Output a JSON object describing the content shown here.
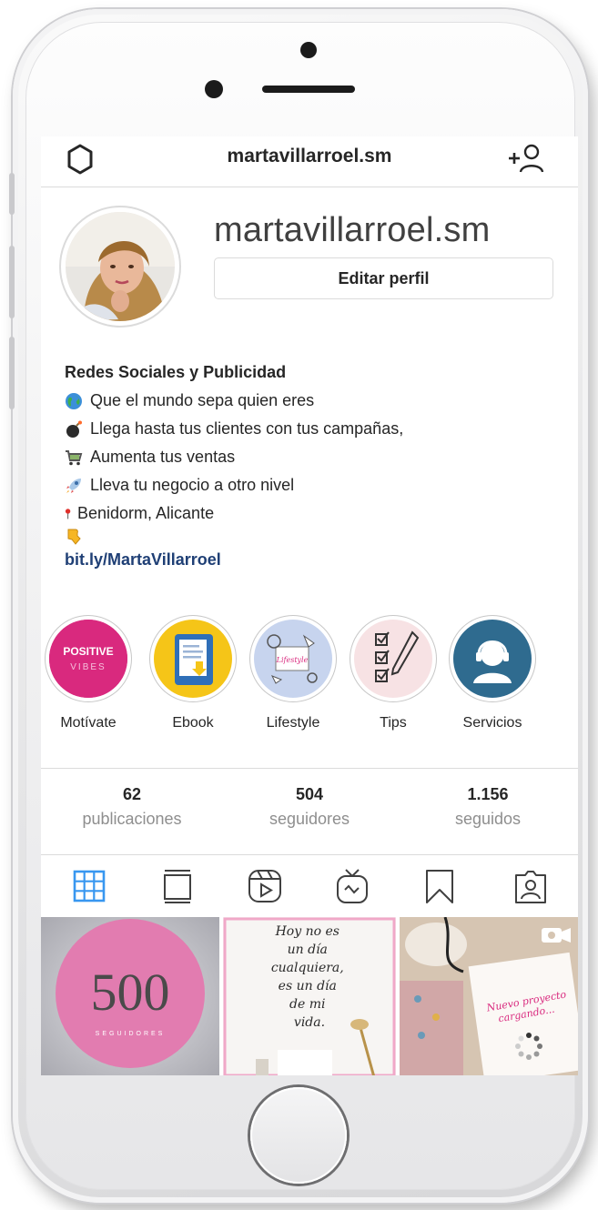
{
  "header": {
    "title": "martavillarroel.sm"
  },
  "profile": {
    "username": "martavillarroel.sm",
    "edit_profile_label": "Editar perfil"
  },
  "bio": {
    "name": "Redes Sociales y Publicidad",
    "lines": [
      {
        "icon": "globe-emoji",
        "text": "Que el mundo sepa quien eres"
      },
      {
        "icon": "bomb-emoji",
        "text": "Llega hasta tus clientes con tus campañas,"
      },
      {
        "icon": "shopping-cart-emoji",
        "text": "Aumenta tus ventas"
      },
      {
        "icon": "rocket-emoji",
        "text": "Lleva tu negocio a otro nivel"
      },
      {
        "icon": "pin-emoji",
        "text": "Benidorm, Alicante"
      },
      {
        "icon": "pointing-down-emoji",
        "text": ""
      }
    ],
    "link": "bit.ly/MartaVillarroel"
  },
  "highlights": [
    {
      "label": "Motívate",
      "cover_text": "POSITIVE VIBES"
    },
    {
      "label": "Ebook"
    },
    {
      "label": "Lifestyle"
    },
    {
      "label": "Tips"
    },
    {
      "label": "Servicios"
    }
  ],
  "stats": [
    {
      "value": "62",
      "label": "publicaciones"
    },
    {
      "value": "504",
      "label": "seguidores"
    },
    {
      "value": "1.156",
      "label": "seguidos"
    }
  ],
  "tabs": [
    {
      "icon": "grid-icon",
      "active": true
    },
    {
      "icon": "feed-icon",
      "active": false
    },
    {
      "icon": "reels-icon",
      "active": false
    },
    {
      "icon": "igtv-icon",
      "active": false
    },
    {
      "icon": "saved-icon",
      "active": false
    },
    {
      "icon": "tagged-icon",
      "active": false
    }
  ],
  "posts": [
    {
      "big_text": "500",
      "small_text": "SEGUIDORES"
    },
    {
      "quote": "Hoy no es un día cualquiera, es un día de mi vida."
    },
    {
      "overlay_text": "Nuevo proyecto cargando..."
    }
  ],
  "colors": {
    "link": "#1f3f75",
    "active_tab": "#3897f0",
    "muted": "#8e8e8e",
    "divider": "#dbdbdb"
  }
}
